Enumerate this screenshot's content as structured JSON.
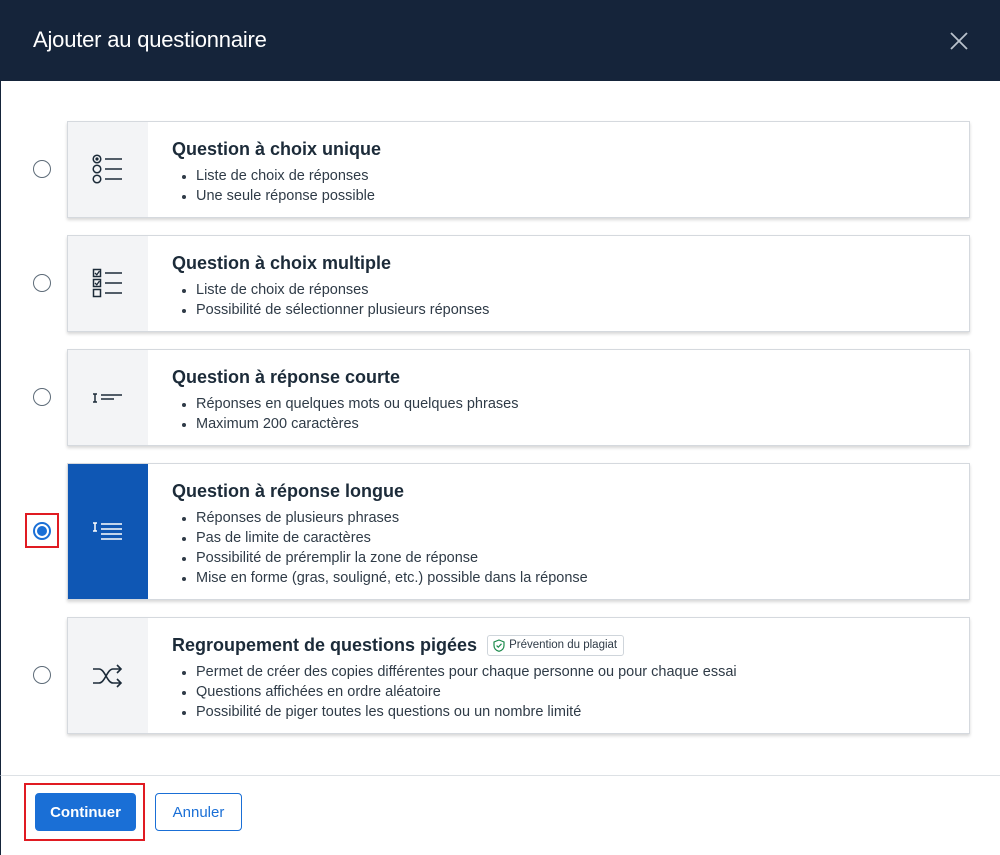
{
  "dialog": {
    "title": "Ajouter au questionnaire",
    "close_label": "Fermer"
  },
  "options": [
    {
      "title": "Question à choix unique",
      "bullets": [
        "Liste de choix de réponses",
        "Une seule réponse possible"
      ],
      "icon": "single-choice-icon",
      "selected": false
    },
    {
      "title": "Question à choix multiple",
      "bullets": [
        "Liste de choix de réponses",
        "Possibilité de sélectionner plusieurs réponses"
      ],
      "icon": "multiple-choice-icon",
      "selected": false
    },
    {
      "title": "Question à réponse courte",
      "bullets": [
        "Réponses en quelques mots ou quelques phrases",
        "Maximum 200 caractères"
      ],
      "icon": "short-answer-icon",
      "selected": false
    },
    {
      "title": "Question à réponse longue",
      "bullets": [
        "Réponses de plusieurs phrases",
        "Pas de limite de caractères",
        "Possibilité de préremplir la zone de réponse",
        "Mise en forme (gras, souligné, etc.) possible dans la réponse"
      ],
      "icon": "long-answer-icon",
      "selected": true
    },
    {
      "title": "Regroupement de questions pigées",
      "badge": "Prévention du plagiat",
      "bullets": [
        "Permet de créer des copies différentes pour chaque personne ou pour chaque essai",
        "Questions affichées en ordre aléatoire",
        "Possibilité de piger toutes les questions ou un nombre limité"
      ],
      "icon": "shuffle-icon",
      "selected": false
    }
  ],
  "footer": {
    "continue_label": "Continuer",
    "cancel_label": "Annuler"
  },
  "colors": {
    "header_bg": "#15243a",
    "accent": "#1a6fd6",
    "selected_icon_bg": "#0f57b4",
    "highlight": "#e01b22"
  }
}
